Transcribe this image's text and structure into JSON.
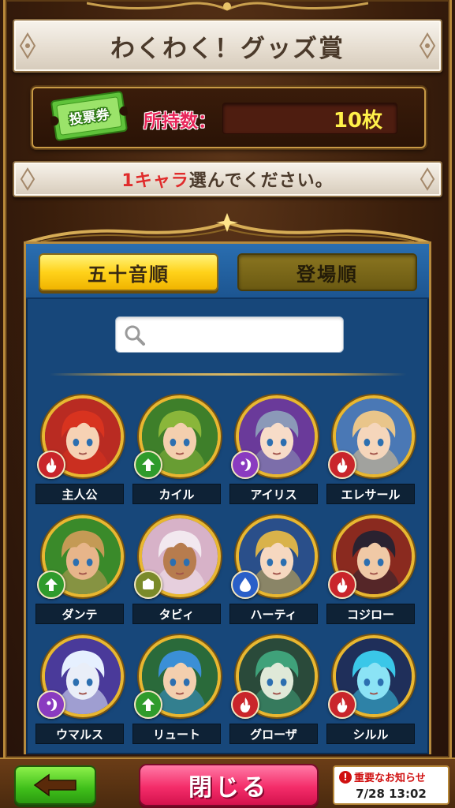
{
  "screen": {
    "title": "わくわく！グッズ賞"
  },
  "ticket": {
    "icon_text": "投票券",
    "label": "所持数：",
    "count": "10枚"
  },
  "instruction": {
    "highlight": "1キャラ",
    "rest": "選んでください。"
  },
  "tabs": [
    {
      "label": "五十音順",
      "active": true
    },
    {
      "label": "登場順",
      "active": false
    }
  ],
  "search": {
    "value": "",
    "placeholder": ""
  },
  "characters": [
    {
      "name": "主人公",
      "element": "red-fire",
      "hair": "#d8331f",
      "skin": "#f6d2b4",
      "bg": "#b92b22"
    },
    {
      "name": "カイル",
      "element": "green-wind",
      "hair": "#8ab63a",
      "skin": "#f3cfae",
      "bg": "#3e7f2a"
    },
    {
      "name": "アイリス",
      "element": "purple-dark",
      "hair": "#8b99b8",
      "skin": "#f7dcc8",
      "bg": "#6a3a9a"
    },
    {
      "name": "エレサール",
      "element": "red-fire",
      "hair": "#e9c58a",
      "skin": "#f5d6bb",
      "bg": "#4a78b5"
    },
    {
      "name": "ダンテ",
      "element": "green-wind",
      "hair": "#c49a55",
      "skin": "#e7b58a",
      "bg": "#3a8a2a"
    },
    {
      "name": "タビィ",
      "element": "green-earth",
      "hair": "#f2e8ef",
      "skin": "#b77c4e",
      "bg": "#d7b2c8"
    },
    {
      "name": "ハーティ",
      "element": "blue-water",
      "hair": "#d9b24a",
      "skin": "#f6d8c0",
      "bg": "#2a4f8a"
    },
    {
      "name": "コジロー",
      "element": "red-fire",
      "hair": "#2a2230",
      "skin": "#f0c9a6",
      "bg": "#8a2a1f"
    },
    {
      "name": "ウマルス",
      "element": "purple-dark",
      "hair": "#e6f0ff",
      "skin": "#e9eef8",
      "bg": "#4a3a9a"
    },
    {
      "name": "リュート",
      "element": "green-wind",
      "hair": "#3b8fd6",
      "skin": "#f3cfae",
      "bg": "#2a6a3a"
    },
    {
      "name": "グローザ",
      "element": "red-fire",
      "hair": "#3fa27a",
      "skin": "#dfe9d8",
      "bg": "#2a4a3a"
    },
    {
      "name": "シルル",
      "element": "red-fire",
      "hair": "#3ac7e8",
      "skin": "#8be3f5",
      "bg": "#1f2f5a"
    }
  ],
  "element_colors": {
    "red-fire": "#c9252b",
    "green-wind": "#2f9b2c",
    "purple-dark": "#8a3bc0",
    "blue-water": "#2a5fc8",
    "green-earth": "#7a8a2a"
  },
  "footer": {
    "back_icon": "arrow-left-icon",
    "close_label": "閉じる",
    "notice_title": "重要なお知らせ",
    "notice_bang": "!",
    "notice_date": "7/28 13:02"
  }
}
